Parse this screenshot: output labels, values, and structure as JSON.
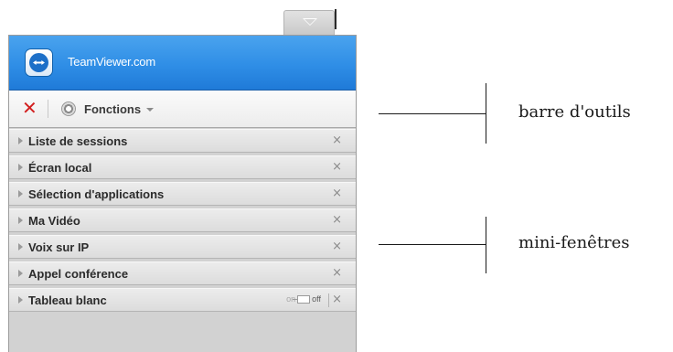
{
  "window": {
    "brand": "TeamViewer.com"
  },
  "toolbar": {
    "close_glyph": "✕",
    "functions_label": "Fonctions"
  },
  "widgets": [
    {
      "label": "Liste de sessions",
      "close": "×"
    },
    {
      "label": "Écran local",
      "close": "×"
    },
    {
      "label": "Sélection d'applications",
      "close": "×"
    },
    {
      "label": "Ma Vidéo",
      "close": "×"
    },
    {
      "label": "Voix sur IP",
      "close": "×"
    },
    {
      "label": "Appel conférence",
      "close": "×"
    },
    {
      "label": "Tableau blanc",
      "close": "×",
      "toggle_on": "on",
      "toggle_off": "off"
    }
  ],
  "annotations": {
    "toolbar": "barre d'outils",
    "widgets": "mini-fenêtres"
  },
  "colors": {
    "header_blue": "#2f8ee6",
    "close_red": "#d21f1f"
  },
  "icons": {
    "collapse": "chevron-down-icon",
    "logo": "teamviewer-logo-icon",
    "close": "close-icon",
    "functions": "gear-icon",
    "expand": "triangle-right-icon"
  }
}
